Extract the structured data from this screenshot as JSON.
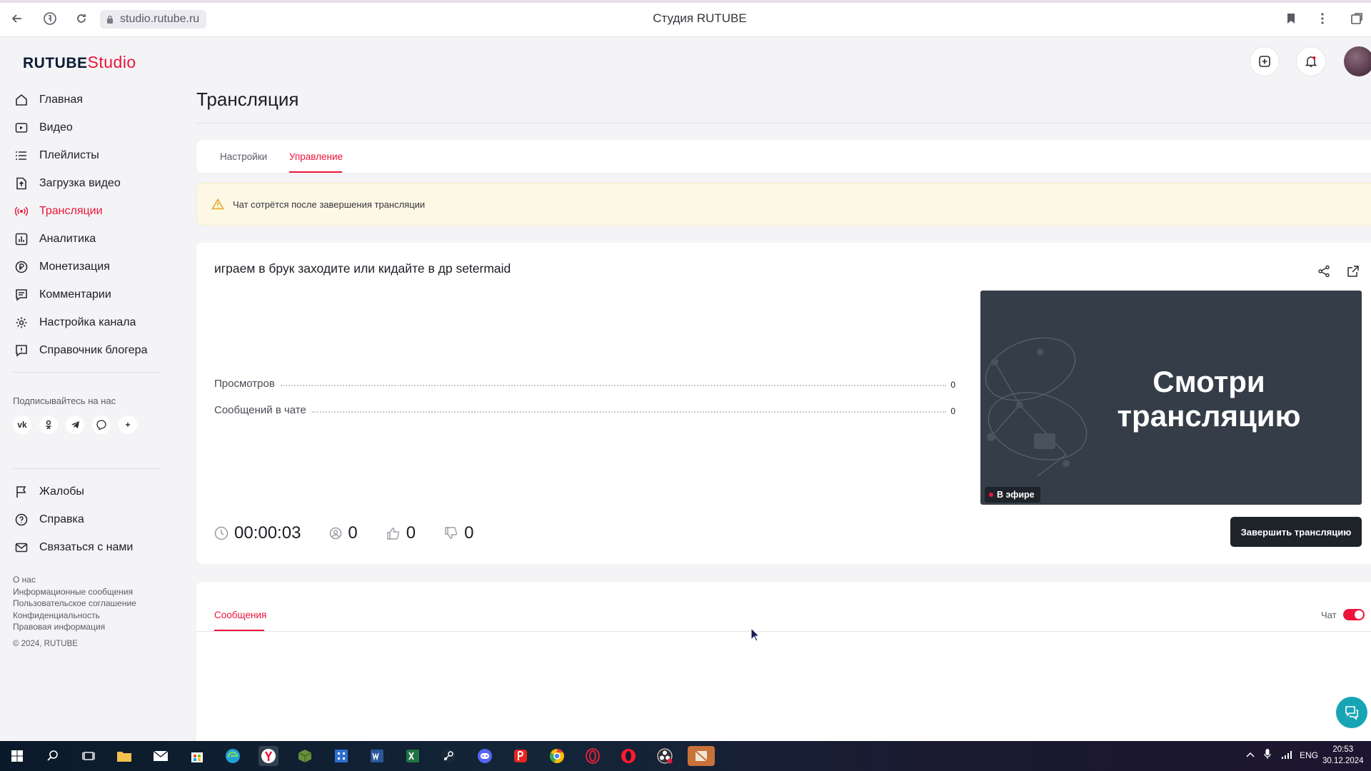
{
  "browser": {
    "url": "studio.rutube.ru",
    "tab_title": "Студия RUTUBE"
  },
  "logo": {
    "brand": "RUTUBE",
    "suffix": "Studio"
  },
  "sidebar": {
    "items": [
      {
        "label": "Главная",
        "icon": "home-icon"
      },
      {
        "label": "Видео",
        "icon": "video-icon"
      },
      {
        "label": "Плейлисты",
        "icon": "playlist-icon"
      },
      {
        "label": "Загрузка видео",
        "icon": "upload-icon"
      },
      {
        "label": "Трансляции",
        "icon": "broadcast-icon",
        "active": true
      },
      {
        "label": "Аналитика",
        "icon": "analytics-icon"
      },
      {
        "label": "Монетизация",
        "icon": "ruble-icon"
      },
      {
        "label": "Комментарии",
        "icon": "comment-icon"
      },
      {
        "label": "Настройка канала",
        "icon": "gear-icon"
      },
      {
        "label": "Справочник блогера",
        "icon": "info-icon"
      }
    ],
    "subscribe_title": "Подписывайтесь на нас",
    "socials": [
      "vk",
      "ok",
      "telegram",
      "viber",
      "+"
    ],
    "secondary": [
      {
        "label": "Жалобы",
        "icon": "flag-icon"
      },
      {
        "label": "Справка",
        "icon": "help-icon"
      },
      {
        "label": "Связаться с нами",
        "icon": "mail-icon"
      }
    ],
    "footer_links": [
      "О нас",
      "Информационные сообщения",
      "Пользовательское соглашение",
      "Конфиденциальность",
      "Правовая информация"
    ],
    "copyright": "© 2024, RUTUBE"
  },
  "page": {
    "title": "Трансляция"
  },
  "tabs": [
    {
      "label": "Настройки"
    },
    {
      "label": "Управление",
      "active": true
    }
  ],
  "warning": {
    "text": "Чат сотрётся после завершения трансляции"
  },
  "stream": {
    "name": "играем в брук заходите или кидайте в др setermaid",
    "stats": [
      {
        "label": "Просмотров",
        "value": "0"
      },
      {
        "label": "Сообщений в чате",
        "value": "0"
      }
    ],
    "metrics": {
      "duration": "00:00:03",
      "viewers": "0",
      "likes": "0",
      "dislikes": "0"
    },
    "preview_text": "Смотри трансляцию",
    "live_label": "В эфире",
    "end_button": "Завершить трансляцию"
  },
  "chat": {
    "tab_label": "Сообщения",
    "toggle_label": "Чат",
    "toggle_on": true
  },
  "taskbar": {
    "lang": "ENG",
    "time": "20:53",
    "date": "30.12.2024"
  },
  "colors": {
    "accent": "#ed143b",
    "dark_button": "#1f232a",
    "fab": "#17a5b5"
  }
}
